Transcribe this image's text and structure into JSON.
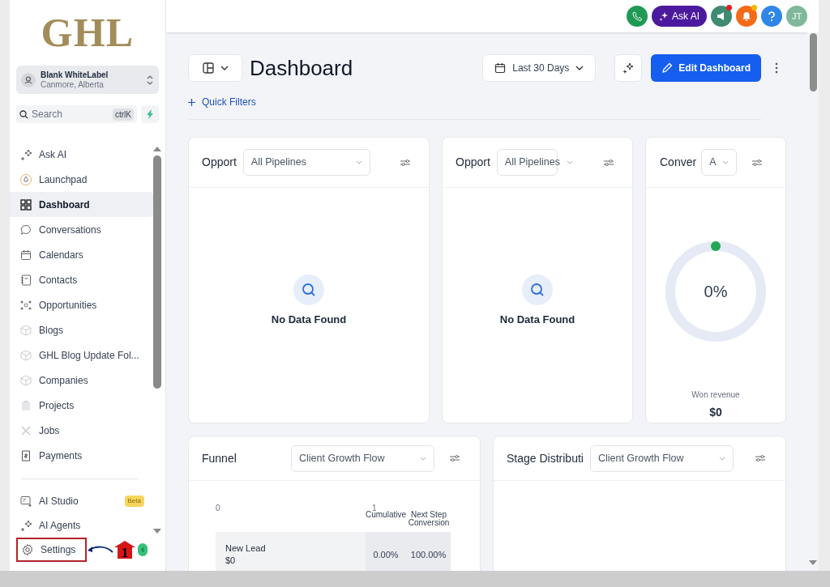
{
  "logo": "GHL",
  "account": {
    "name": "Blank WhiteLabel",
    "location": "Canmore, Alberta"
  },
  "search": {
    "placeholder": "Search",
    "shortcut": "ctrlK"
  },
  "nav": [
    {
      "label": "Ask AI",
      "selected": false
    },
    {
      "label": "Launchpad",
      "selected": false
    },
    {
      "label": "Dashboard",
      "selected": true
    },
    {
      "label": "Conversations",
      "selected": false
    },
    {
      "label": "Calendars",
      "selected": false
    },
    {
      "label": "Contacts",
      "selected": false
    },
    {
      "label": "Opportunities",
      "selected": false
    },
    {
      "label": "Blogs",
      "selected": false
    },
    {
      "label": "GHL Blog Update Fol...",
      "selected": false
    },
    {
      "label": "Companies",
      "selected": false
    },
    {
      "label": "Projects",
      "selected": false
    },
    {
      "label": "Jobs",
      "selected": false
    },
    {
      "label": "Payments",
      "selected": false
    }
  ],
  "bottom_nav": [
    {
      "label": "AI Studio",
      "badge": "Beta",
      "highlighted": false
    },
    {
      "label": "AI Agents",
      "highlighted": false
    },
    {
      "label": "Settings",
      "highlighted": true
    }
  ],
  "annotation": {
    "number": "1"
  },
  "topbar": {
    "ask_ai": "Ask AI",
    "avatar": "JT"
  },
  "header": {
    "title": "Dashboard",
    "date_range": "Last 30 Days",
    "edit_button": "Edit Dashboard",
    "quick_filters": "Quick Filters"
  },
  "widgets": [
    {
      "kind": "empty",
      "title": "Opport",
      "filter": "All Pipelines",
      "message": "No Data Found"
    },
    {
      "kind": "empty",
      "title": "Opport",
      "filter": "All Pipelines",
      "message": "No Data Found"
    },
    {
      "kind": "donut",
      "title": "Conver",
      "filter": "A",
      "value": "0%",
      "caption": "Won revenue",
      "amount": "$0"
    },
    {
      "kind": "funnel",
      "title": "Funnel",
      "filter": "Client Growth Flow",
      "axis": [
        "0",
        "1"
      ],
      "columns": [
        "Cumulative",
        "Next Step Conversion"
      ],
      "rows": [
        {
          "stage": "New Lead",
          "amount": "$0",
          "cumulative": "0.00%",
          "next_step": "100.00%"
        }
      ]
    },
    {
      "kind": "blank",
      "title": "Stage Distributi",
      "filter": "Client Growth Flow"
    }
  ]
}
